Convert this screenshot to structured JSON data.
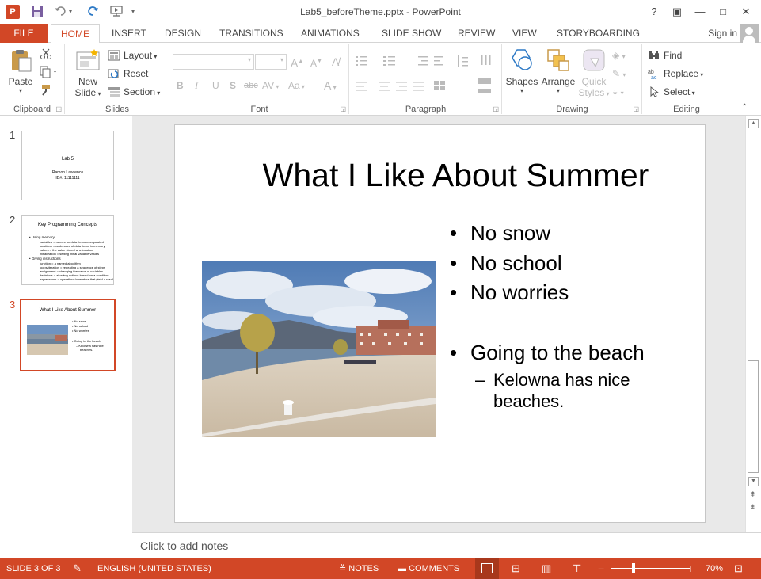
{
  "window": {
    "title": "Lab5_beforeTheme.pptx - PowerPoint",
    "app_logo": "P",
    "controls": [
      "?",
      "▣",
      "—",
      "□",
      "✕"
    ]
  },
  "tabs": {
    "file": "FILE",
    "home": "HOME",
    "insert": "INSERT",
    "design": "DESIGN",
    "transitions": "TRANSITIONS",
    "animations": "ANIMATIONS",
    "slide_show": "SLIDE SHOW",
    "review": "REVIEW",
    "view": "VIEW",
    "storyboarding": "STORYBOARDING",
    "signin": "Sign in"
  },
  "ribbon": {
    "clipboard": {
      "label": "Clipboard",
      "paste": "Paste"
    },
    "slides": {
      "label": "Slides",
      "new_slide_1": "New",
      "new_slide_2": "Slide",
      "layout": "Layout",
      "reset": "Reset",
      "section": "Section"
    },
    "font": {
      "label": "Font",
      "bold": "B",
      "italic": "I",
      "underline": "U",
      "shadow": "S",
      "strike": "abc",
      "spacing": "AV",
      "case": "Aa",
      "color": "A"
    },
    "paragraph": {
      "label": "Paragraph"
    },
    "drawing": {
      "label": "Drawing",
      "shapes": "Shapes",
      "arrange": "Arrange",
      "quick_1": "Quick",
      "quick_2": "Styles"
    },
    "editing": {
      "label": "Editing",
      "find": "Find",
      "replace": "Replace",
      "select": "Select"
    }
  },
  "thumbnails": [
    {
      "num": "1",
      "title": "Lab 5",
      "lines": [
        "Ramon Lawrence",
        "ID#: 11111111"
      ]
    },
    {
      "num": "2",
      "title": "Key Programming Concepts",
      "lines": [
        "• Using memory",
        "variables = names for data items manipulated",
        "locations = addresses of data items in memory",
        "values = the value stored at a location",
        "initialization = setting initial variable values",
        "• Giving instructions",
        "function = a named algorithm",
        "loops/iteration = repeating a sequence of steps",
        "assignment = changing the value of variables",
        "decisions = allowing actions based on a condition",
        "expressions = operations/operators that yield a result"
      ]
    },
    {
      "num": "3",
      "title": "What I Like About Summer",
      "lines": [
        "• No snow",
        "• No school",
        "• No worries",
        "• Going to the beach",
        "– Kelowna has nice",
        "beaches."
      ]
    }
  ],
  "slide": {
    "title": "What I Like About Summer",
    "bullets": [
      "No snow",
      "No school",
      "No worries",
      "Going to the beach"
    ],
    "sub_bullet_line1": "Kelowna has nice",
    "sub_bullet_line2": "beaches."
  },
  "notes_placeholder": "Click to add notes",
  "status": {
    "slide_of": "SLIDE 3 OF 3",
    "language": "ENGLISH (UNITED STATES)",
    "notes": "NOTES",
    "comments": "COMMENTS",
    "zoom_minus": "−",
    "zoom_plus": "+",
    "zoom": "70%"
  },
  "colors": {
    "accent": "#d24726",
    "ribbon_bg": "#ffffff",
    "canvas_bg": "#e9e9e9"
  }
}
